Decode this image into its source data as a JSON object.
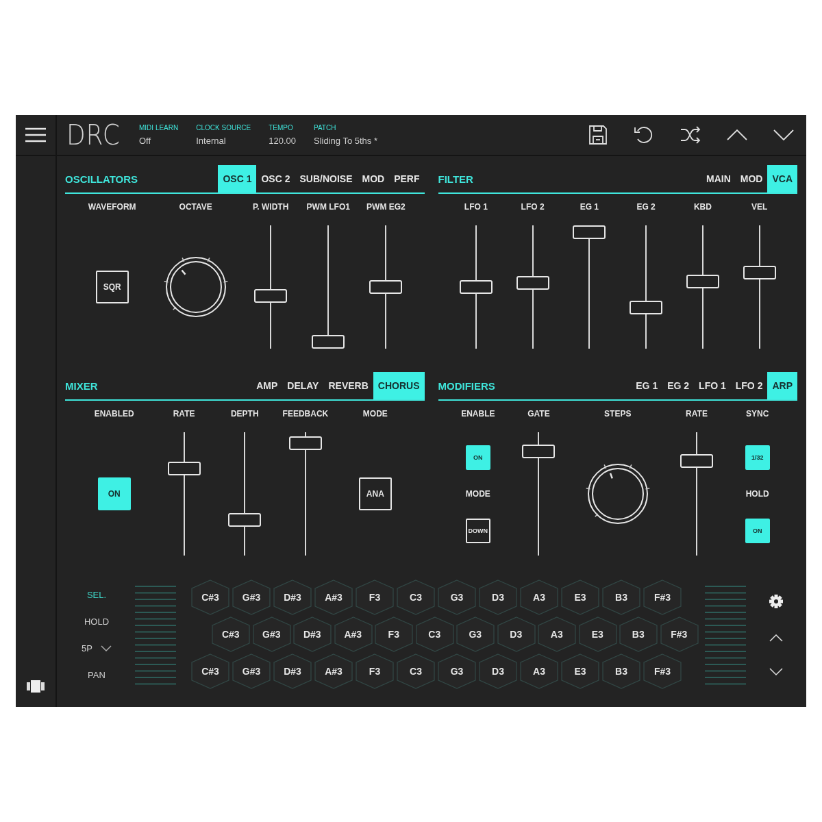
{
  "header": {
    "logo": "DRC",
    "fields": [
      {
        "label": "MIDI LEARN",
        "value": "Off"
      },
      {
        "label": "CLOCK SOURCE",
        "value": "Internal"
      },
      {
        "label": "TEMPO",
        "value": "120.00"
      },
      {
        "label": "PATCH",
        "value": "Sliding To 5ths *"
      }
    ]
  },
  "panels": [
    {
      "title": "OSCILLATORS",
      "tabs": [
        {
          "label": "OSC 1",
          "selected": true
        },
        {
          "label": "OSC 2",
          "selected": false
        },
        {
          "label": "SUB/NOISE",
          "selected": false
        },
        {
          "label": "MOD",
          "selected": false
        },
        {
          "label": "PERF",
          "selected": false
        }
      ],
      "columns": [
        {
          "label": "WAVEFORM",
          "widgets": [
            {
              "kind": "button",
              "text": "SQR",
              "on": false
            }
          ]
        },
        {
          "label": "OCTAVE",
          "widgets": [
            {
              "kind": "knob"
            }
          ]
        },
        {
          "label": "P. WIDTH",
          "widgets": [
            {
              "kind": "slider",
              "level": 0.42
            }
          ]
        },
        {
          "label": "PWM LFO1",
          "widgets": [
            {
              "kind": "slider",
              "level": 0
            }
          ]
        },
        {
          "label": "PWM EG2",
          "widgets": [
            {
              "kind": "slider",
              "level": 0.5
            }
          ]
        }
      ]
    },
    {
      "title": "FILTER",
      "tabs": [
        {
          "label": "MAIN",
          "selected": false
        },
        {
          "label": "MOD",
          "selected": false
        },
        {
          "label": "VCA",
          "selected": true
        }
      ],
      "columns": [
        {
          "label": "LFO 1",
          "widgets": [
            {
              "kind": "slider",
              "level": 0.5
            }
          ]
        },
        {
          "label": "LFO 2",
          "widgets": [
            {
              "kind": "slider",
              "level": 0.54
            }
          ]
        },
        {
          "label": "EG 1",
          "widgets": [
            {
              "kind": "slider",
              "level": 1
            }
          ]
        },
        {
          "label": "EG 2",
          "widgets": [
            {
              "kind": "slider",
              "level": 0.31
            }
          ]
        },
        {
          "label": "KBD",
          "widgets": [
            {
              "kind": "slider",
              "level": 0.55
            }
          ]
        },
        {
          "label": "VEL",
          "widgets": [
            {
              "kind": "slider",
              "level": 0.63
            }
          ]
        }
      ]
    },
    {
      "title": "MIXER",
      "tabs": [
        {
          "label": "AMP",
          "selected": false
        },
        {
          "label": "DELAY",
          "selected": false
        },
        {
          "label": "REVERB",
          "selected": false
        },
        {
          "label": "CHORUS",
          "selected": true
        }
      ],
      "columns": [
        {
          "label": "ENABLED",
          "widgets": [
            {
              "kind": "button",
              "text": "ON",
              "on": true
            }
          ]
        },
        {
          "label": "RATE",
          "widgets": [
            {
              "kind": "slider",
              "level": 0.73
            }
          ]
        },
        {
          "label": "DEPTH",
          "widgets": [
            {
              "kind": "slider",
              "level": 0.26
            }
          ]
        },
        {
          "label": "FEEDBACK",
          "widgets": [
            {
              "kind": "slider",
              "level": 0.96
            }
          ]
        },
        {
          "label": "MODE",
          "widgets": [
            {
              "kind": "button",
              "text": "ANA",
              "on": false
            }
          ]
        }
      ]
    },
    {
      "title": "MODIFIERS",
      "tabs": [
        {
          "label": "EG 1",
          "selected": false
        },
        {
          "label": "EG 2",
          "selected": false
        },
        {
          "label": "LFO 1",
          "selected": false
        },
        {
          "label": "LFO 2",
          "selected": false
        },
        {
          "label": "ARP",
          "selected": true
        }
      ],
      "columns": [
        {
          "label": "ENABLE",
          "widgets": [
            {
              "kind": "smallbutton",
              "text": "ON",
              "on": true
            },
            {
              "kind": "caption",
              "text": "MODE"
            },
            {
              "kind": "smallbutton",
              "text": "DOWN",
              "on": false
            }
          ]
        },
        {
          "label": "GATE",
          "widgets": [
            {
              "kind": "slider",
              "level": 0.89
            }
          ]
        },
        {
          "label": "STEPS",
          "widgets": [
            {
              "kind": "knob"
            }
          ]
        },
        {
          "label": "RATE",
          "widgets": [
            {
              "kind": "slider",
              "level": 0.8
            }
          ]
        },
        {
          "label": "SYNC",
          "widgets": [
            {
              "kind": "smallbutton",
              "text": "1/32",
              "on": true
            },
            {
              "kind": "caption",
              "text": "HOLD"
            },
            {
              "kind": "smallbutton",
              "text": "ON",
              "on": true
            }
          ]
        }
      ]
    }
  ],
  "keyboard": {
    "side_items": [
      {
        "kind": "option",
        "text": "SEL.",
        "selected": true
      },
      {
        "kind": "option",
        "text": "HOLD",
        "selected": false
      },
      {
        "kind": "dropdown",
        "text": "5P"
      },
      {
        "kind": "option",
        "text": "PAN",
        "selected": false
      }
    ],
    "rows": [
      {
        "keys": [
          "C#3",
          "G#3",
          "D#3",
          "A#3",
          "F3",
          "C3",
          "G3",
          "D3",
          "A3",
          "E3",
          "B3",
          "F#3"
        ]
      },
      {
        "keys": [
          "C#3",
          "G#3",
          "D#3",
          "A#3",
          "F3",
          "C3",
          "G3",
          "D3",
          "A3",
          "E3",
          "B3",
          "F#3"
        ]
      },
      {
        "keys": [
          "C#3",
          "G#3",
          "D#3",
          "A#3",
          "F3",
          "C3",
          "G3",
          "D3",
          "A3",
          "E3",
          "B3",
          "F#3"
        ]
      }
    ]
  }
}
